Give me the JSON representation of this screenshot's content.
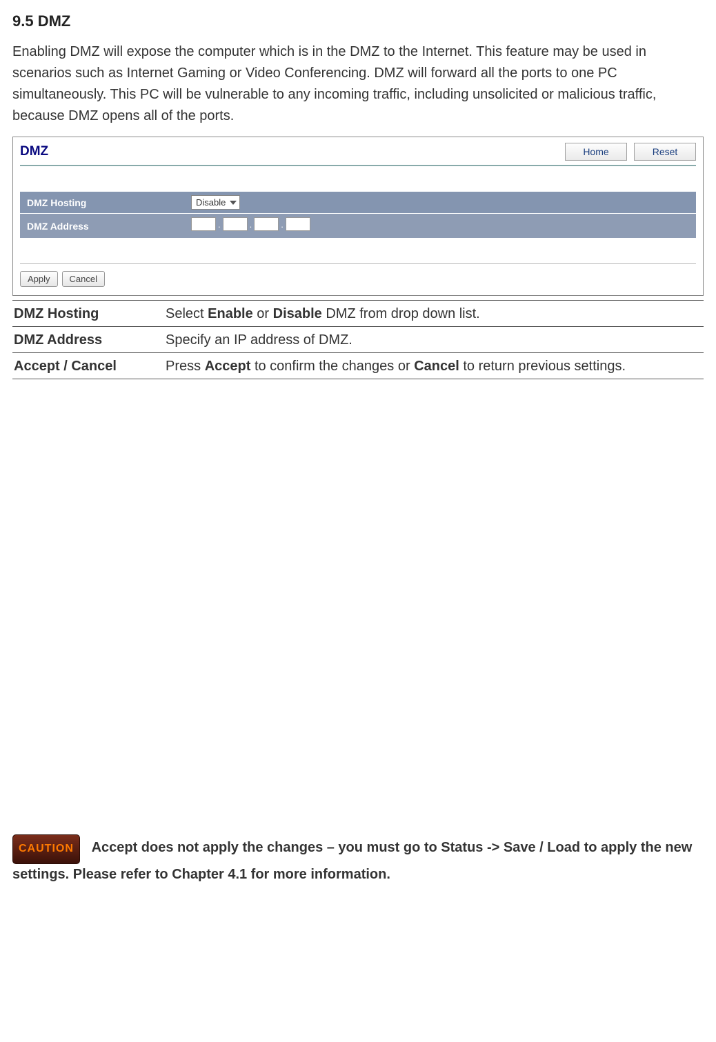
{
  "section": {
    "heading": "9.5 DMZ",
    "intro": "Enabling DMZ will expose the computer which is in the DMZ to the Internet. This feature may be used in scenarios such as Internet Gaming or Video Conferencing. DMZ will forward all the ports to one PC simultaneously. This PC will be vulnerable to any incoming traffic, including unsolicited or malicious traffic, because DMZ opens all of the ports."
  },
  "router": {
    "title": "DMZ",
    "home_btn": "Home",
    "reset_btn": "Reset",
    "hosting_label": "DMZ Hosting",
    "hosting_value": "Disable",
    "address_label": "DMZ Address",
    "apply_btn": "Apply",
    "cancel_btn": "Cancel"
  },
  "desc": {
    "row1_label": "DMZ Hosting",
    "row1_pre": "Select ",
    "row1_b1": "Enable",
    "row1_mid": " or ",
    "row1_b2": "Disable",
    "row1_post": " DMZ from drop down list.",
    "row2_label": "DMZ Address",
    "row2_text": "Specify an IP address of DMZ.",
    "row3_label": "Accept / Cancel",
    "row3_pre": "Press ",
    "row3_b1": "Accept",
    "row3_mid": " to confirm the changes or ",
    "row3_b2": "Cancel",
    "row3_post": " to return previous settings."
  },
  "caution": {
    "badge": "CAUTION",
    "text": "Accept does not apply the changes – you must go to Status -> Save / Load to apply the new settings. Please refer to Chapter 4.1 for more information."
  }
}
